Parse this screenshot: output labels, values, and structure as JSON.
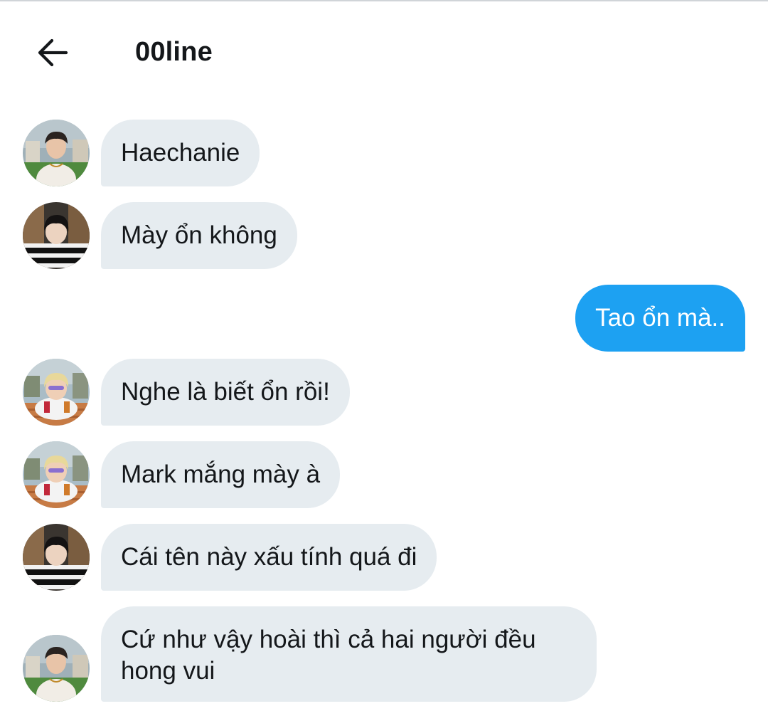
{
  "header": {
    "title": "00line",
    "back_icon": "arrow-left-icon"
  },
  "colors": {
    "received_bubble": "#e6ecf0",
    "sent_bubble": "#1da1f2",
    "text": "#14171a"
  },
  "messages": [
    {
      "sender": "avatar-a",
      "direction": "received",
      "text": "Haechanie"
    },
    {
      "sender": "avatar-b",
      "direction": "received",
      "text": "Mày ổn không"
    },
    {
      "sender": "me",
      "direction": "sent",
      "text": "Tao ổn mà.."
    },
    {
      "sender": "avatar-c",
      "direction": "received",
      "text": "Nghe là biết ổn rồi!"
    },
    {
      "sender": "avatar-c",
      "direction": "received",
      "text": "Mark mắng mày à"
    },
    {
      "sender": "avatar-b",
      "direction": "received",
      "text": "Cái tên này xấu tính quá đi"
    },
    {
      "sender": "avatar-a",
      "direction": "received",
      "text": "Cứ như vậy hoài thì cả hai người đều hong vui"
    }
  ]
}
